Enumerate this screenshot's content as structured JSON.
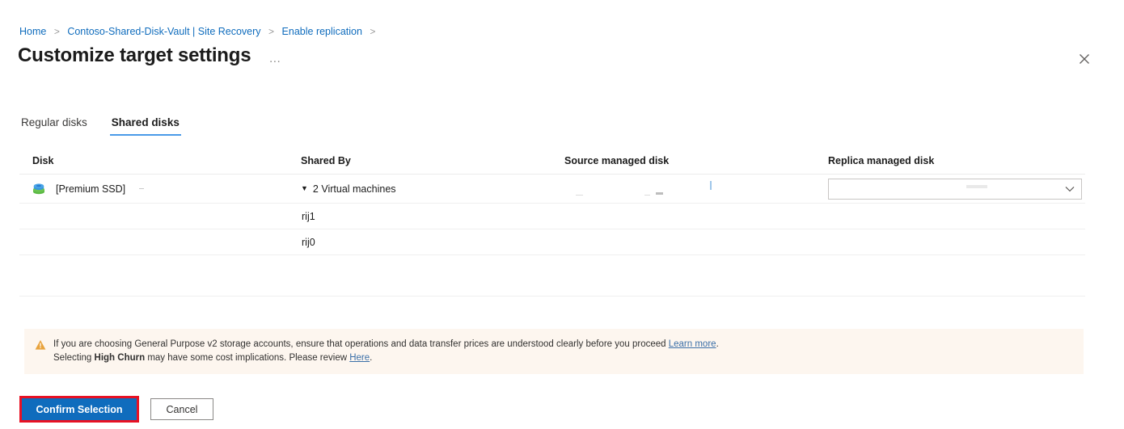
{
  "breadcrumb": {
    "separator": ">",
    "items": [
      {
        "label": "Home"
      },
      {
        "label": "Contoso-Shared-Disk-Vault | Site Recovery"
      },
      {
        "label": "Enable replication"
      }
    ]
  },
  "header": {
    "title": "Customize target settings",
    "overflow_label": "…",
    "close_label": "×"
  },
  "tabs": [
    {
      "label": "Regular disks",
      "active": false
    },
    {
      "label": "Shared disks",
      "active": true
    }
  ],
  "table": {
    "columns": [
      {
        "key": "disk",
        "label": "Disk"
      },
      {
        "key": "shared_by",
        "label": "Shared By"
      },
      {
        "key": "source_managed_disk",
        "label": "Source managed disk"
      },
      {
        "key": "replica_managed_disk",
        "label": "Replica managed disk"
      }
    ],
    "rows": [
      {
        "disk_icon": "managed-disk-icon",
        "disk": "[Premium SSD]",
        "shared_by": "2 Virtual machines",
        "shared_by_caret": "▼",
        "source_managed_disk": "",
        "replica_managed_disk": "",
        "replica_caret": "chevron-down-icon"
      },
      {
        "disk": "",
        "shared_by": "rij1",
        "source_managed_disk": "",
        "replica_managed_disk": ""
      },
      {
        "disk": "",
        "shared_by": "rij0",
        "source_managed_disk": "",
        "replica_managed_disk": ""
      }
    ]
  },
  "banner": {
    "icon": "warning-icon",
    "line1_prefix": "If you are choosing General Purpose v2 storage accounts, ensure that operations and data transfer prices are understood clearly before you proceed ",
    "line1_link": "Learn more",
    "line1_suffix": ".",
    "line2_prefix": "Selecting ",
    "line2_bold": "High Churn",
    "line2_mid": " may have some cost implications. Please review ",
    "line2_link": "Here",
    "line2_suffix": "."
  },
  "footer": {
    "confirm_label": "Confirm Selection",
    "cancel_label": "Cancel"
  },
  "colors": {
    "accent": "#0f6cbd",
    "link": "#0f6cbd",
    "tab_underline": "#4a9be8",
    "banner_bg": "#fdf6ef",
    "warning": "#e8a33d",
    "highlight_border": "#e81123",
    "disk_icon_top": "#3a96dd",
    "disk_icon_bottom": "#5dba46"
  }
}
